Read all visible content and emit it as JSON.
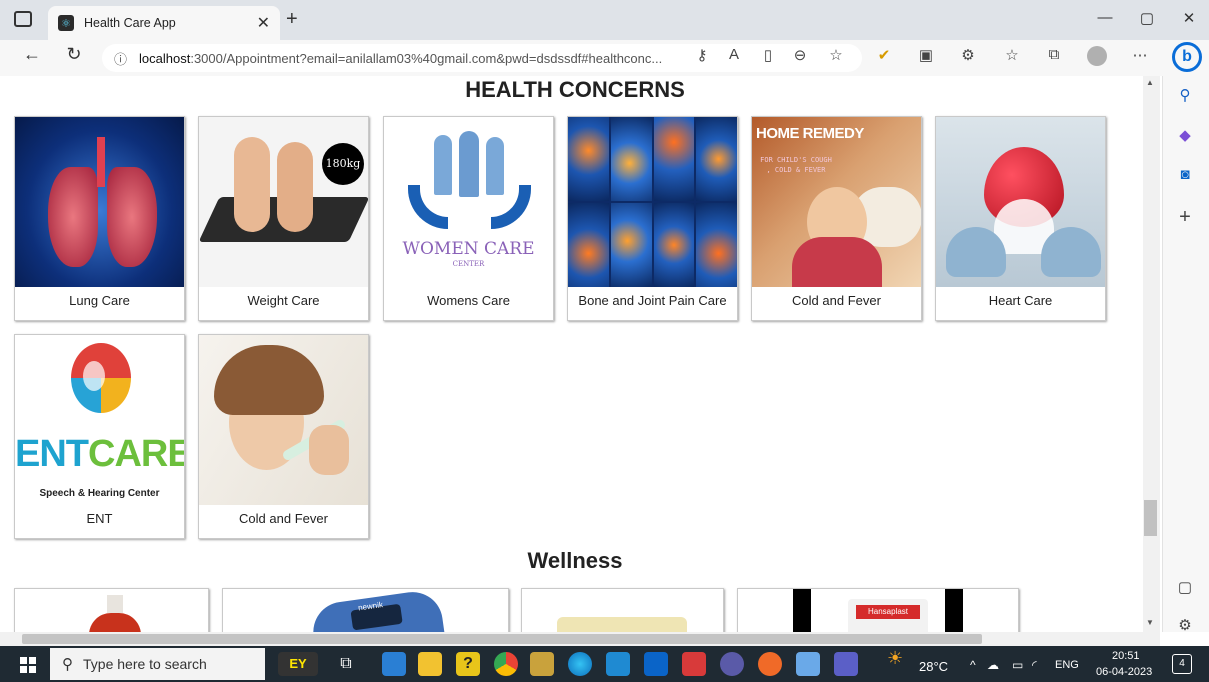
{
  "browser": {
    "tab_title": "Health Care App",
    "url_host": "localhost",
    "url_rest": ":3000/Appointment?email=anilallam03%40gmail.com&pwd=dsdssdf#healthconc...",
    "more": "⋯"
  },
  "page": {
    "section_title": "HEALTH CONCERNS",
    "concerns": [
      {
        "label": "Lung Care",
        "icon": "lungs-image"
      },
      {
        "label": "Weight Care",
        "icon": "weight-scale-image",
        "badge": "180kg"
      },
      {
        "label": "Womens Care",
        "icon": "women-care-logo",
        "logo_text": "WOMEN CARE",
        "logo_sub": "CENTER"
      },
      {
        "label": "Bone and Joint Pain Care",
        "icon": "joint-pain-image"
      },
      {
        "label": "Cold and Fever",
        "icon": "home-remedy-image",
        "overlay": "HOME REMEDY",
        "overlay_sub": "FOR CHILD'S COUGH , COLD & FEVER"
      },
      {
        "label": "Heart Care",
        "icon": "heart-hands-image"
      },
      {
        "label": "ENT",
        "icon": "ent-care-logo",
        "logo_text": "ENTCARE",
        "logo_sub": "Speech & Hearing Center"
      },
      {
        "label": "Cold and Fever",
        "icon": "child-thermometer-image"
      }
    ],
    "wellness_title": "Wellness",
    "wellness_items": [
      {
        "icon": "antiseptic-bottle-image"
      },
      {
        "icon": "pulse-oximeter-image",
        "brand": "newnik"
      },
      {
        "icon": "soap-bar-image"
      },
      {
        "icon": "bandage-box-image",
        "brand": "Hansaplast"
      }
    ]
  },
  "taskbar": {
    "search_placeholder": "Type here to search",
    "weather": "28°C",
    "language": "ENG",
    "time": "20:51",
    "date": "06-04-2023",
    "notifications": "4"
  },
  "colors": {
    "accent": "#0078d4",
    "taskbar": "#1f2a33",
    "titlebar": "#dfe3e8"
  }
}
